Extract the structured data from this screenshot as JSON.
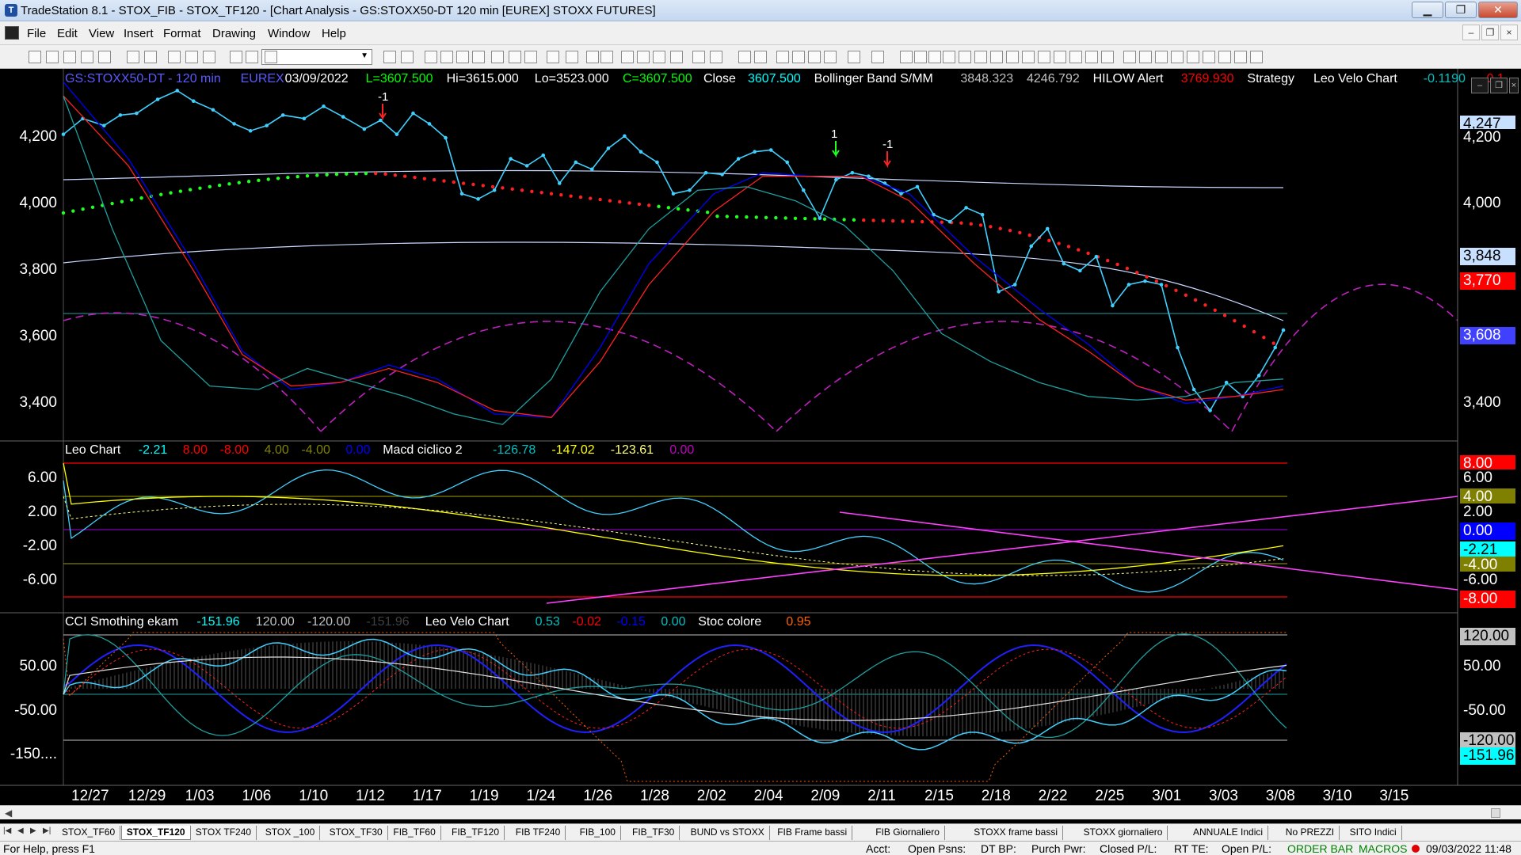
{
  "window": {
    "title": "TradeStation 8.1 - STOX_FIB - STOX_TF120 - [Chart Analysis - GS:STOXX50-DT  120 min  [EUREX] STOXX FUTURES]",
    "app_icon": "tradestation-logo-icon",
    "minimize": "▁",
    "restore": "❐",
    "close": "✕"
  },
  "menu": [
    "File",
    "Edit",
    "View",
    "Insert",
    "Format",
    "Drawing",
    "Window",
    "Help"
  ],
  "mdi_controls": [
    "–",
    "❐",
    "×"
  ],
  "price_header": [
    {
      "t": "GS:STOXX50-DT - 120 min",
      "c": "#5a5aff"
    },
    {
      "t": "EUREX",
      "c": "#5a5aff"
    },
    {
      "t": "03/09/2022",
      "c": "#ffffff"
    },
    {
      "t": "L=3607.500",
      "c": "#00ff00"
    },
    {
      "t": "Hi=3615.000",
      "c": "#ffffff"
    },
    {
      "t": "Lo=3523.000",
      "c": "#ffffff"
    },
    {
      "t": "C=3607.500",
      "c": "#00ff00"
    },
    {
      "t": "Close",
      "c": "#ffffff"
    },
    {
      "t": "3607.500",
      "c": "#00ffff"
    },
    {
      "t": "Bollinger Band S/MM",
      "c": "#ffffff"
    },
    {
      "t": "3848.323",
      "c": "#c0c0c0"
    },
    {
      "t": "4246.792",
      "c": "#c0c0c0"
    },
    {
      "t": "HILOW Alert",
      "c": "#ffffff"
    },
    {
      "t": "3769.930",
      "c": "#ff0000"
    },
    {
      "t": "Strategy",
      "c": "#ffffff"
    },
    {
      "t": "Leo Velo Chart",
      "c": "#ffffff"
    },
    {
      "t": "-0.1190",
      "c": "#00c0c0"
    },
    {
      "t": "-0.1...",
      "c": "#ff0000"
    }
  ],
  "leo_header": [
    {
      "t": "Leo Chart",
      "c": "#ffffff"
    },
    {
      "t": "-2.21",
      "c": "#00ffff"
    },
    {
      "t": "8.00",
      "c": "#ff0000"
    },
    {
      "t": "-8.00",
      "c": "#ff0000"
    },
    {
      "t": "4.00",
      "c": "#808000"
    },
    {
      "t": "-4.00",
      "c": "#808000"
    },
    {
      "t": "0.00",
      "c": "#0000ff"
    },
    {
      "t": "Macd ciclico 2",
      "c": "#ffffff"
    },
    {
      "t": "-126.78",
      "c": "#00c0c0"
    },
    {
      "t": "-147.02",
      "c": "#ffff00"
    },
    {
      "t": "-123.61",
      "c": "#ffff80"
    },
    {
      "t": "0.00",
      "c": "#c000c0"
    }
  ],
  "cci_header": [
    {
      "t": "CCI Smothing ekam",
      "c": "#ffffff"
    },
    {
      "t": "-151.96",
      "c": "#00ffff"
    },
    {
      "t": "120.00",
      "c": "#c0c0c0"
    },
    {
      "t": "-120.00",
      "c": "#c0c0c0"
    },
    {
      "t": "-151.96",
      "c": "#404040"
    },
    {
      "t": "Leo Velo Chart",
      "c": "#ffffff"
    },
    {
      "t": "0.53",
      "c": "#00c0c0"
    },
    {
      "t": "-0.02",
      "c": "#ff0000"
    },
    {
      "t": "-0.15",
      "c": "#0000ff"
    },
    {
      "t": "0.00",
      "c": "#00c0c0"
    },
    {
      "t": "Stoc colore",
      "c": "#ffffff"
    },
    {
      "t": "0.95",
      "c": "#ff6000"
    }
  ],
  "price_axis": [
    "4,200",
    "4,000",
    "3,800",
    "3,600",
    "3,400"
  ],
  "leo_axis": [
    "6.00",
    "2.00",
    "-2.00",
    "-6.00"
  ],
  "cci_axis": [
    "50.00",
    "-50.00",
    "-150...."
  ],
  "x_axis": [
    "12/27",
    "12/29",
    "1/03",
    "1/06",
    "1/10",
    "1/12",
    "1/17",
    "1/19",
    "1/24",
    "1/26",
    "1/28",
    "2/02",
    "2/04",
    "2/09",
    "2/11",
    "2/15",
    "2/18",
    "2/22",
    "2/25",
    "3/01",
    "3/03",
    "3/08",
    "3/10",
    "3/15"
  ],
  "right_tags_price": [
    {
      "t": "4,247",
      "bg": "#c8e0ff",
      "fg": "#000"
    },
    {
      "t": "4,200",
      "bg": "#000",
      "fg": "#fff"
    },
    {
      "t": "4,000",
      "bg": "#000",
      "fg": "#fff"
    },
    {
      "t": "3,848",
      "bg": "#c8e0ff",
      "fg": "#000"
    },
    {
      "t": "3,770",
      "bg": "#ff0000",
      "fg": "#fff"
    },
    {
      "t": "3,608",
      "bg": "#4040ff",
      "fg": "#fff"
    },
    {
      "t": "3,400",
      "bg": "#000",
      "fg": "#fff"
    }
  ],
  "right_tags_leo": [
    {
      "t": "8.00",
      "bg": "#ff0000",
      "fg": "#fff"
    },
    {
      "t": "6.00",
      "bg": "#000",
      "fg": "#fff"
    },
    {
      "t": "4.00",
      "bg": "#808000",
      "fg": "#fff"
    },
    {
      "t": "2.00",
      "bg": "#000",
      "fg": "#fff"
    },
    {
      "t": "0.00",
      "bg": "#0000ff",
      "fg": "#fff"
    },
    {
      "t": "-2.21",
      "bg": "#00ffff",
      "fg": "#000"
    },
    {
      "t": "-4.00",
      "bg": "#808000",
      "fg": "#fff"
    },
    {
      "t": "-6.00",
      "bg": "#000",
      "fg": "#fff"
    },
    {
      "t": "-8.00",
      "bg": "#ff0000",
      "fg": "#fff"
    }
  ],
  "right_tags_cci": [
    {
      "t": "120.00",
      "bg": "#c0c0c0",
      "fg": "#000"
    },
    {
      "t": "50.00",
      "bg": "#000",
      "fg": "#fff"
    },
    {
      "t": "-50.00",
      "bg": "#000",
      "fg": "#fff"
    },
    {
      "t": "-120.00",
      "bg": "#c0c0c0",
      "fg": "#000"
    },
    {
      "t": "-151.96",
      "bg": "#00ffff",
      "fg": "#000"
    }
  ],
  "markers": [
    "-1",
    "1",
    "-1"
  ],
  "chart_data": {
    "type": "line",
    "price_pane": {
      "ylim": [
        3320,
        4330
      ],
      "series": [
        {
          "name": "Close",
          "color": "#40d0ff",
          "points": [
            [
              0,
              4170
            ],
            [
              12,
              4215
            ],
            [
              25,
              4195
            ],
            [
              35,
              4225
            ],
            [
              45,
              4230
            ],
            [
              58,
              4270
            ],
            [
              70,
              4295
            ],
            [
              80,
              4265
            ],
            [
              92,
              4240
            ],
            [
              105,
              4200
            ],
            [
              115,
              4180
            ],
            [
              125,
              4195
            ],
            [
              135,
              4225
            ],
            [
              148,
              4215
            ],
            [
              160,
              4250
            ],
            [
              172,
              4220
            ],
            [
              185,
              4185
            ],
            [
              195,
              4210
            ],
            [
              205,
              4170
            ],
            [
              215,
              4230
            ],
            [
              225,
              4200
            ],
            [
              235,
              4160
            ],
            [
              245,
              4000
            ],
            [
              255,
              3985
            ],
            [
              265,
              4010
            ],
            [
              275,
              4100
            ],
            [
              285,
              4080
            ],
            [
              295,
              4110
            ],
            [
              305,
              4030
            ],
            [
              315,
              4090
            ],
            [
              325,
              4070
            ],
            [
              335,
              4130
            ],
            [
              345,
              4165
            ],
            [
              355,
              4120
            ],
            [
              365,
              4090
            ],
            [
              375,
              4000
            ],
            [
              385,
              4010
            ],
            [
              395,
              4060
            ],
            [
              405,
              4055
            ],
            [
              415,
              4100
            ],
            [
              425,
              4120
            ],
            [
              435,
              4125
            ],
            [
              445,
              4090
            ],
            [
              455,
              4010
            ],
            [
              465,
              3930
            ],
            [
              475,
              4040
            ],
            [
              485,
              4060
            ],
            [
              495,
              4050
            ],
            [
              505,
              4030
            ],
            [
              515,
              4000
            ],
            [
              525,
              4020
            ],
            [
              535,
              3940
            ],
            [
              545,
              3920
            ],
            [
              555,
              3960
            ],
            [
              565,
              3940
            ],
            [
              575,
              3720
            ],
            [
              585,
              3740
            ],
            [
              595,
              3850
            ],
            [
              605,
              3900
            ],
            [
              615,
              3800
            ],
            [
              625,
              3780
            ],
            [
              635,
              3820
            ],
            [
              645,
              3680
            ],
            [
              655,
              3740
            ],
            [
              665,
              3750
            ],
            [
              675,
              3740
            ],
            [
              685,
              3560
            ],
            [
              695,
              3440
            ],
            [
              705,
              3380
            ],
            [
              715,
              3460
            ],
            [
              725,
              3420
            ],
            [
              735,
              3480
            ],
            [
              745,
              3560
            ],
            [
              750,
              3610
            ]
          ]
        },
        {
          "name": "",
          "color": "#0000ff",
          "points": [
            [
              0,
              4320
            ],
            [
              40,
              4100
            ],
            [
              80,
              3800
            ],
            [
              110,
              3550
            ],
            [
              140,
              3440
            ],
            [
              170,
              3460
            ],
            [
              200,
              3510
            ],
            [
              230,
              3470
            ],
            [
              265,
              3370
            ],
            [
              300,
              3360
            ],
            [
              330,
              3560
            ],
            [
              360,
              3800
            ],
            [
              400,
              4000
            ],
            [
              430,
              4060
            ],
            [
              460,
              4050
            ],
            [
              490,
              4050
            ],
            [
              520,
              4000
            ],
            [
              560,
              3820
            ],
            [
              600,
              3670
            ],
            [
              630,
              3570
            ],
            [
              660,
              3450
            ],
            [
              690,
              3400
            ],
            [
              720,
              3420
            ],
            [
              750,
              3450
            ]
          ]
        },
        {
          "name": "",
          "color": "#ff2020",
          "points": [
            [
              0,
              4280
            ],
            [
              40,
              4080
            ],
            [
              80,
              3780
            ],
            [
              110,
              3540
            ],
            [
              140,
              3450
            ],
            [
              170,
              3460
            ],
            [
              200,
              3500
            ],
            [
              230,
              3460
            ],
            [
              265,
              3380
            ],
            [
              300,
              3360
            ],
            [
              330,
              3520
            ],
            [
              360,
              3740
            ],
            [
              400,
              3950
            ],
            [
              430,
              4050
            ],
            [
              460,
              4050
            ],
            [
              490,
              4050
            ],
            [
              520,
              3980
            ],
            [
              560,
              3800
            ],
            [
              600,
              3640
            ],
            [
              630,
              3550
            ],
            [
              660,
              3450
            ],
            [
              690,
              3410
            ],
            [
              720,
              3420
            ],
            [
              750,
              3440
            ]
          ]
        },
        {
          "name": "",
          "color": "#1f9f9f",
          "points": [
            [
              0,
              4280
            ],
            [
              30,
              3900
            ],
            [
              60,
              3580
            ],
            [
              90,
              3450
            ],
            [
              120,
              3440
            ],
            [
              150,
              3500
            ],
            [
              180,
              3460
            ],
            [
              210,
              3420
            ],
            [
              240,
              3370
            ],
            [
              270,
              3340
            ],
            [
              300,
              3470
            ],
            [
              330,
              3720
            ],
            [
              360,
              3900
            ],
            [
              390,
              4010
            ],
            [
              420,
              4020
            ],
            [
              450,
              3980
            ],
            [
              480,
              3910
            ],
            [
              510,
              3780
            ],
            [
              540,
              3600
            ],
            [
              570,
              3520
            ],
            [
              600,
              3460
            ],
            [
              630,
              3420
            ],
            [
              660,
              3410
            ],
            [
              690,
              3420
            ],
            [
              720,
              3460
            ],
            [
              750,
              3470
            ]
          ]
        }
      ]
    }
  },
  "sheet_tabs": [
    "STOX_TF60",
    "STOX_TF120",
    "STOX TF240",
    "STOX _100",
    "STOX_TF30",
    "FIB_TF60",
    "FIB_TF120",
    "FIB TF240",
    "FIB_100",
    "FIB_TF30",
    "BUND vs STOXX",
    "FIB Frame bassi",
    "FIB Giornaliero",
    "STOXX frame bassi",
    "STOXX giornaliero",
    "ANNUALE Indici",
    "No PREZZI",
    "SITO Indici"
  ],
  "active_tab": "STOX_TF120",
  "status": {
    "help": "For Help, press F1",
    "acct": "Acct:",
    "open_psns": "Open Psns:",
    "dt_bp": "DT BP:",
    "purch_pwr": "Purch Pwr:",
    "closed_pl": "Closed P/L:",
    "rt_te": "RT TE:",
    "open_pl": "Open P/L:",
    "order_bar": "ORDER BAR",
    "macros": "MACROS",
    "datetime": "09/03/2022 11:48"
  }
}
